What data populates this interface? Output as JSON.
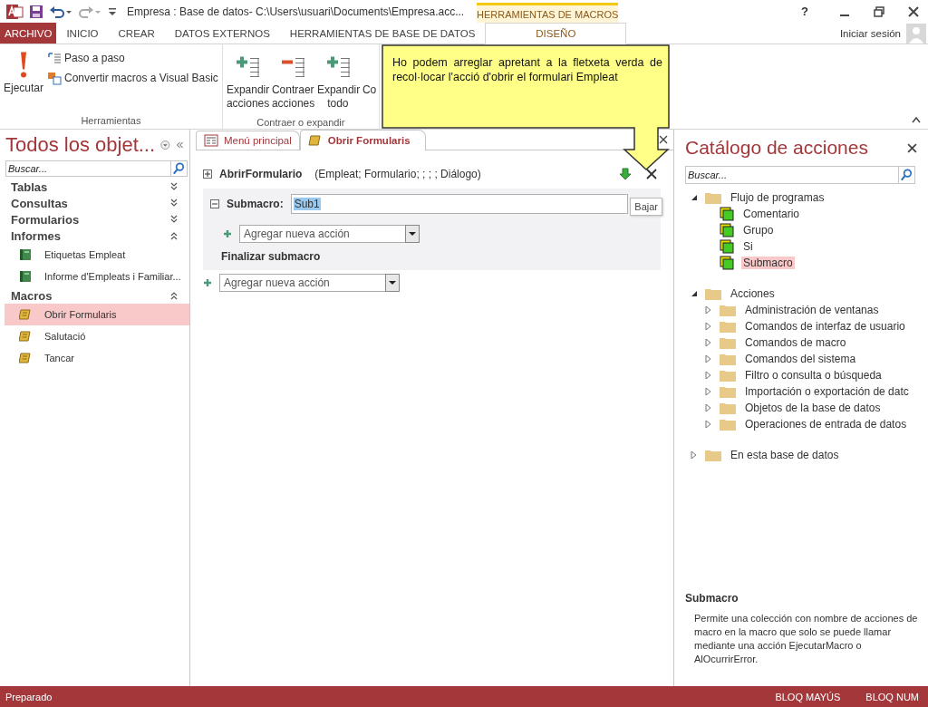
{
  "title_bar": {
    "title": "Empresa : Base de datos- C:\\Users\\usuari\\Documents\\Empresa.acc...",
    "context_tab": "HERRAMIENTAS DE MACROS",
    "help": "?"
  },
  "ribbon_tabs": [
    {
      "label": "ARCHIVO",
      "kind": "file",
      "selected": false
    },
    {
      "label": "INICIO",
      "kind": "tab",
      "selected": false
    },
    {
      "label": "CREAR",
      "kind": "tab",
      "selected": false
    },
    {
      "label": "DATOS EXTERNOS",
      "kind": "tab",
      "selected": false
    },
    {
      "label": "HERRAMIENTAS DE BASE DE DATOS",
      "kind": "tab",
      "selected": false
    },
    {
      "label": "DISEÑO",
      "kind": "tab",
      "selected": true
    }
  ],
  "sign_in": "Iniciar sesión",
  "ribbon_groups": [
    {
      "label": "Herramientas",
      "buttons": [
        {
          "kind": "run",
          "label": "Ejecutar"
        },
        {
          "kind": "step",
          "label": "Paso a paso"
        },
        {
          "kind": "convert",
          "label": "Convertir macros a Visual Basic"
        }
      ]
    },
    {
      "label": "Contraer o expandir",
      "buttons": [
        {
          "kind": "expand",
          "label": "Expandir acciones"
        },
        {
          "kind": "collapse",
          "label": "Contraer acciones"
        },
        {
          "kind": "expand",
          "label": "Expandir todo"
        },
        {
          "kind": "cut",
          "label": "Co"
        }
      ]
    }
  ],
  "callout": {
    "text": "Ho podem arreglar apretant a la fletxeta verda de recol·locar l'acció d'obrir el formulari Empleat"
  },
  "nav_pane": {
    "title": "Todos los objet...",
    "search": {
      "placeholder": "Buscar..."
    },
    "groups": [
      {
        "label": "Tablas",
        "expanded": false
      },
      {
        "label": "Consultas",
        "expanded": false
      },
      {
        "label": "Formularios",
        "expanded": false
      },
      {
        "label": "Informes",
        "expanded": true,
        "items": [
          {
            "label": "Etiquetas Empleat",
            "kind": "report",
            "selected": false
          },
          {
            "label": "Informe d'Empleats i Familiar...",
            "kind": "report",
            "selected": false
          }
        ]
      },
      {
        "label": "Macros",
        "expanded": true,
        "items": [
          {
            "label": "Obrir Formularis",
            "kind": "macro",
            "selected": true
          },
          {
            "label": "Salutació",
            "kind": "macro",
            "selected": false
          },
          {
            "label": "Tancar",
            "kind": "macro",
            "selected": false
          }
        ]
      }
    ]
  },
  "doc_tabs": [
    {
      "label": "Menú principal",
      "kind": "form",
      "selected": false
    },
    {
      "label": "Obrir Formularis",
      "kind": "macro",
      "selected": true
    }
  ],
  "macro": {
    "action": {
      "name": "AbrirFormulario",
      "args": "(Empleat; Formulario; ; ; ; Diálogo)",
      "expanded": false
    },
    "tooltip": "Bajar",
    "submacro": {
      "label": "Submacro:",
      "value": "Sub1",
      "expanded": true,
      "add_action": {
        "placeholder": "Agregar nueva acción"
      },
      "end_label": "Finalizar submacro"
    },
    "add_action": {
      "placeholder": "Agregar nueva acción"
    }
  },
  "catalog": {
    "title": "Catálogo de acciones",
    "search": {
      "placeholder": "Buscar..."
    },
    "tree": [
      {
        "label": "Flujo de programas",
        "kind": "folder",
        "expanded": true,
        "selected": false,
        "children": [
          {
            "label": "Comentario",
            "kind": "action",
            "selected": false
          },
          {
            "label": "Grupo",
            "kind": "action",
            "selected": false
          },
          {
            "label": "Si",
            "kind": "action",
            "selected": false
          },
          {
            "label": "Submacro",
            "kind": "action",
            "selected": true
          }
        ]
      },
      {
        "label": "Acciones",
        "kind": "folder",
        "expanded": true,
        "selected": false,
        "children": [
          {
            "label": "Administración de ventanas",
            "kind": "folder",
            "expanded": false,
            "selected": false
          },
          {
            "label": "Comandos de interfaz de usuario",
            "kind": "folder",
            "expanded": false,
            "selected": false
          },
          {
            "label": "Comandos de macro",
            "kind": "folder",
            "expanded": false,
            "selected": false
          },
          {
            "label": "Comandos del sistema",
            "kind": "folder",
            "expanded": false,
            "selected": false
          },
          {
            "label": "Filtro o consulta o búsqueda",
            "kind": "folder",
            "expanded": false,
            "selected": false
          },
          {
            "label": "Importación o exportación de datc",
            "kind": "folder",
            "expanded": false,
            "selected": false
          },
          {
            "label": "Objetos de la base de datos",
            "kind": "folder",
            "expanded": false,
            "selected": false
          },
          {
            "label": "Operaciones de entrada de datos",
            "kind": "folder",
            "expanded": false,
            "selected": false
          }
        ]
      },
      {
        "label": "En esta base de datos",
        "kind": "folder",
        "expanded": false,
        "selected": false
      }
    ],
    "description": {
      "title": "Submacro",
      "text": "Permite una colección con nombre de acciones de macro en la macro que solo se puede llamar mediante una acción EjecutarMacro o AlOcurrirError."
    }
  },
  "status_bar": {
    "left": "Preparado",
    "indicators": [
      "BLOQ MAYÚS",
      "BLOQ NUM"
    ]
  }
}
